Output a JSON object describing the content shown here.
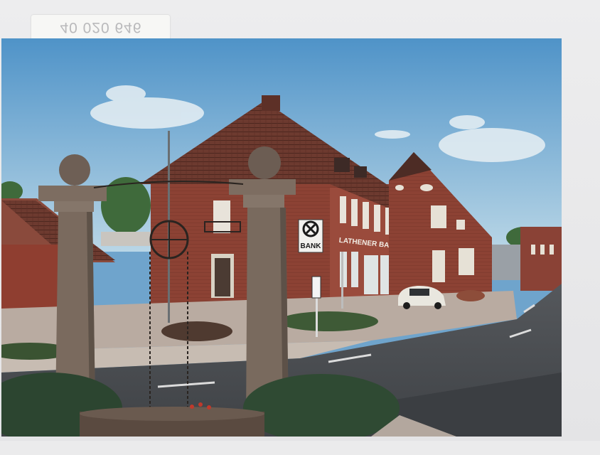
{
  "scan": {
    "sticker_text": "40 020 646"
  },
  "photo": {
    "bank_sign": {
      "logo_text": "BANK",
      "facade_lettering": "LATHENER BANK eG",
      "logo_symbol": "raiffeisen-cross-icon"
    },
    "colors": {
      "sky_top": "#4f93c8",
      "sky_bottom": "#b9d6e6",
      "brick": "#8e3f33",
      "roof": "#6b3b30",
      "road": "#4a4d52",
      "sidewalk": "#b9aba1",
      "pillar": "#7b6b5f",
      "hedge": "#2f4a33"
    }
  }
}
